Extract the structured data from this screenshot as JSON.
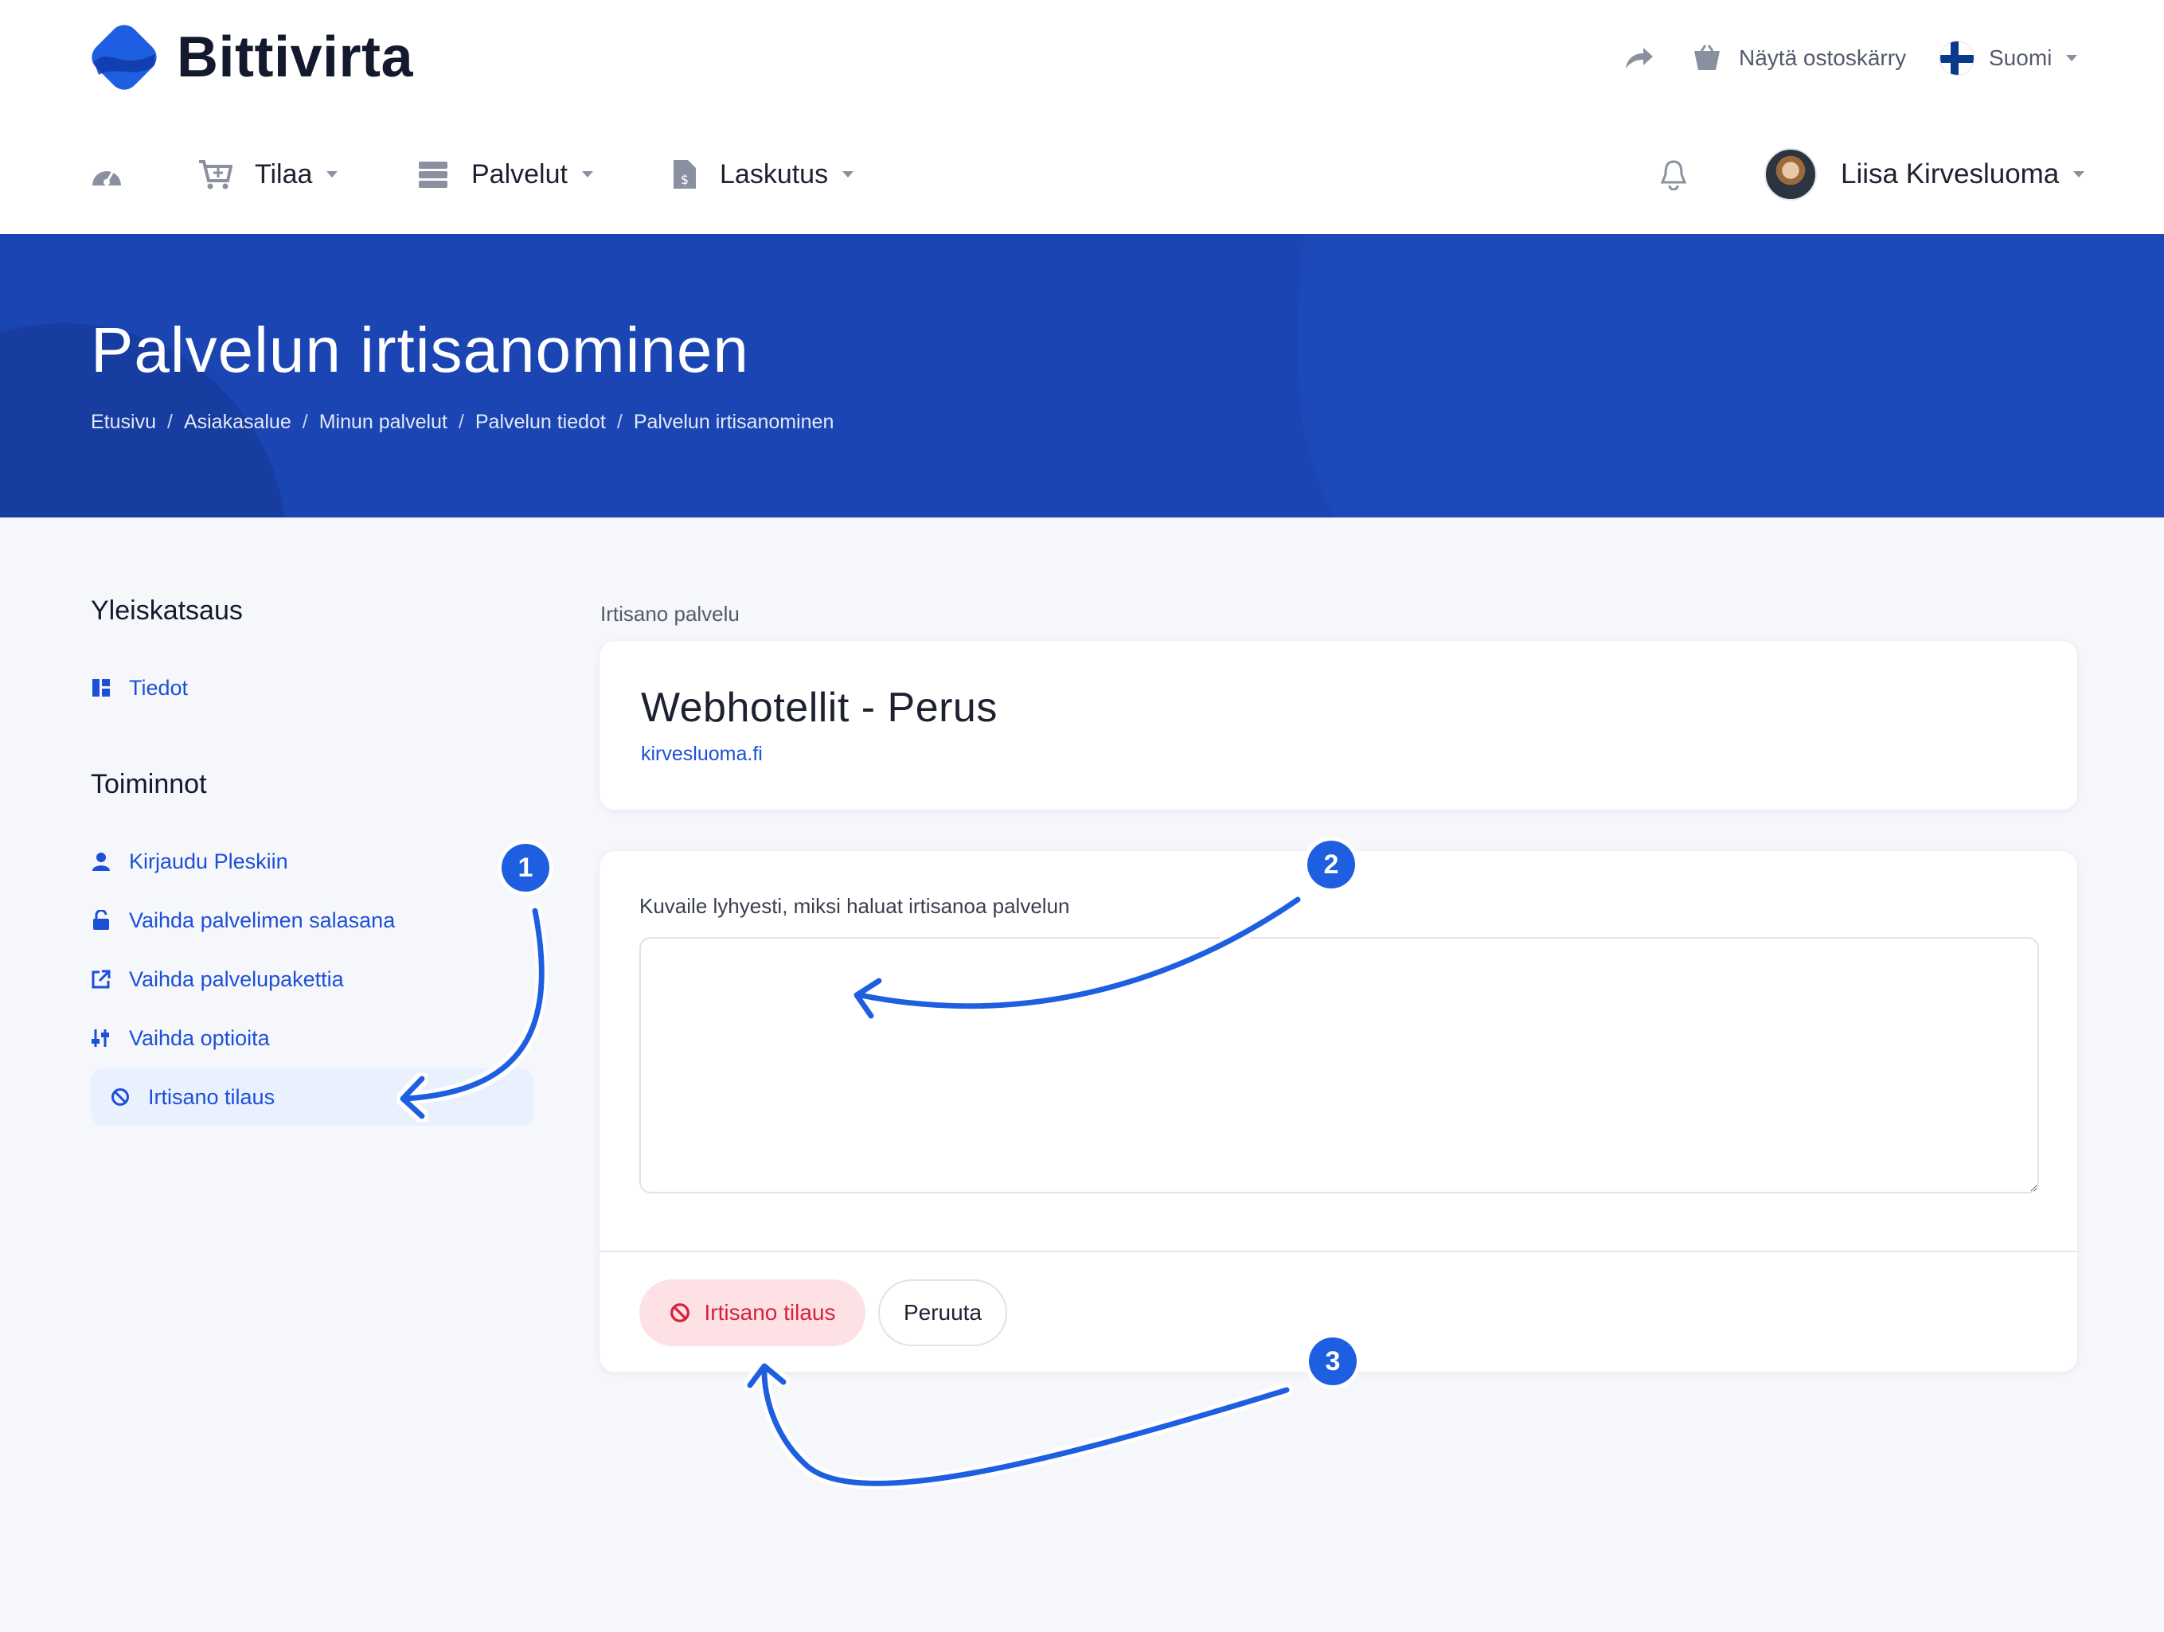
{
  "brand": {
    "name": "Bittivirta",
    "color": "#1d5fe0"
  },
  "utility": {
    "share_icon": "share-arrow-icon",
    "cart_label": "Näytä ostoskärry",
    "language_label": "Suomi"
  },
  "nav": {
    "order": "Tilaa",
    "services": "Palvelut",
    "billing": "Laskutus",
    "user_name": "Liisa Kirvesluoma"
  },
  "hero": {
    "title": "Palvelun irtisanominen",
    "breadcrumb": [
      "Etusivu",
      "Asiakasalue",
      "Minun palvelut",
      "Palvelun tiedot",
      "Palvelun irtisanominen"
    ],
    "background": "#1b45b2"
  },
  "sidebar": {
    "overview_heading": "Yleiskatsaus",
    "overview_items": [
      {
        "label": "Tiedot",
        "icon": "dashboard-icon"
      }
    ],
    "actions_heading": "Toiminnot",
    "action_items": [
      {
        "label": "Kirjaudu Pleskiin",
        "icon": "user-icon"
      },
      {
        "label": "Vaihda palvelimen salasana",
        "icon": "unlock-icon"
      },
      {
        "label": "Vaihda palvelupakettia",
        "icon": "external-link-icon"
      },
      {
        "label": "Vaihda optioita",
        "icon": "sliders-icon"
      },
      {
        "label": "Irtisano tilaus",
        "icon": "ban-icon",
        "active": true
      }
    ]
  },
  "main": {
    "section_label": "Irtisano palvelu",
    "service_name": "Webhotellit - Perus",
    "service_domain": "kirvesluoma.fi",
    "reason_label": "Kuvaile lyhyesti, miksi haluat irtisanoa palvelun",
    "reason_value": "",
    "cancel_button": "Irtisano tilaus",
    "back_button": "Peruuta"
  },
  "annotations": [
    "1",
    "2",
    "3"
  ],
  "colors": {
    "link": "#1d4fd8",
    "danger": "#d6233b",
    "danger_bg": "#fde1e4",
    "page_bg": "#f6f7fb"
  }
}
